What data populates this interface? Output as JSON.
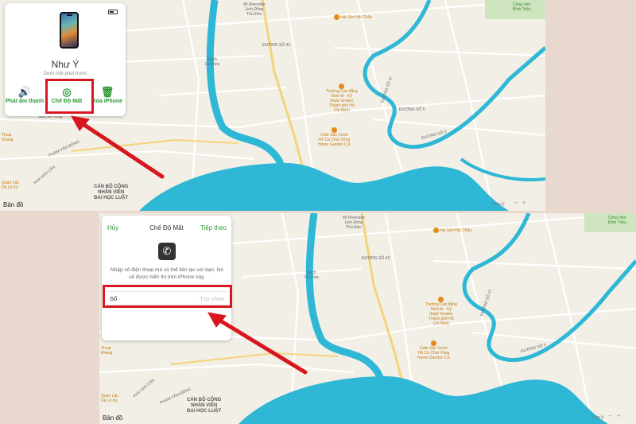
{
  "top_panel": {
    "device_card": {
      "name": "Như Ý",
      "subtitle": "Dưới một phút trước",
      "actions": [
        {
          "label": "Phát âm thanh",
          "icon": "speaker-icon"
        },
        {
          "label": "Chế Độ Mất",
          "icon": "lost-mode-icon"
        },
        {
          "label": "Xóa iPhone",
          "icon": "trash-icon"
        }
      ]
    },
    "map": {
      "logo": "Bản đồ",
      "legal": "Pháp lý",
      "labels": {
        "poi_hai_chau": "Hải Sản Hải Châu",
        "riverside": "45 Riverside\nLinh Đông\nThủ Đức",
        "rach_go_dua": "Rạch\nGò Dưa",
        "truong_cao_dang": "Trường Cao đẳng\nKinh tế - Kỹ\nthuật Vinatex\nThành phố Hồ\nChí Minh",
        "cafe": "Cafe Sân Vườn\nHồ Cá Chơi Vồng\nHome Garden C.K",
        "can_bo": "CÁN BỘ CÔNG\nNHÂN VIÊN\nĐẠI HỌC LUẬT",
        "thoai_khang": "Thoại\nKhang",
        "quan_lau": "Quán Lẩu\nDê Lê Ký",
        "pham_van_dong": "PHẠM VĂN ĐỒNG",
        "kha_van_can": "KHA VẠN CÂN",
        "duong_so_42": "ĐƯỜNG SỐ 42",
        "duong_so_3": "ĐƯỜNG SỐ 3",
        "duong_so_37": "ĐƯỜNG SỐ 37",
        "duong_so_5": "ĐƯỜNG SỐ 5",
        "luu_dan_ban": "LƯU ĐẠN BẢN",
        "sua_xe": "Sửa Xe Hùng",
        "cong_vien": "Công viên\nBình Triệu"
      }
    }
  },
  "bottom_panel": {
    "dialog": {
      "cancel": "Hủy",
      "title": "Chế Độ Mất",
      "next": "Tiếp theo",
      "description": "Nhập số điện thoại mà có thể liên lạc với bạn. Nó sẽ được hiển thị trên iPhone này.",
      "number_label": "Số",
      "number_placeholder": "Tùy chọn"
    },
    "map": {
      "logo": "Bản đồ",
      "legal": "Pháp lý",
      "labels": {
        "poi_hai_chau": "Hải Sản Hải Châu",
        "riverside": "45 Riverside\nLinh Đông\nThủ Đức",
        "rach_go_dua": "Rạch\nGò Dưa",
        "truong_cao_dang": "Trường Cao đẳng\nKinh tế - Kỹ\nthuật Vinatex\nThành phố Hồ\nChí Minh",
        "cafe": "Cafe Sân Vườn\nHồ Cá Chơi Vồng\nHome Garden C.K",
        "can_bo": "CÁN BỘ CÔNG\nNHÂN VIÊN\nĐẠI HỌC LUẬT",
        "thoai_khang": "Thoại\nKhang",
        "quan_lau": "Quán Lẩu\nDê Lê Ký",
        "pham_van_dong": "PHẠM VĂN ĐỒNG",
        "kha_van_can": "KHA VẠN CÂN",
        "duong_so_42": "ĐƯỜNG SỐ 42",
        "duong_so_3": "ĐƯỜNG SỐ 3",
        "duong_so_37": "ĐƯỜNG SỐ 37",
        "cong_vien": "Công viên\nBình Triệu"
      }
    }
  },
  "colors": {
    "accent_green": "#2f9a35",
    "highlight_red": "#d9161f",
    "water": "#2fb7d6",
    "land": "#f2efe6"
  }
}
